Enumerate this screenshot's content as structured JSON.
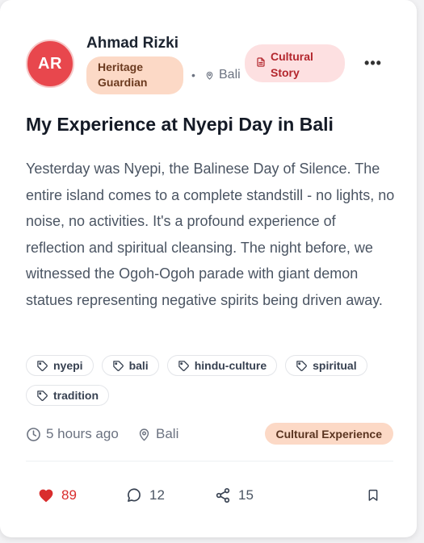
{
  "author": {
    "initials": "AR",
    "name": "Ahmad Rizki",
    "badge_line1": "Heritage",
    "badge_line2": "Guardian",
    "location": "Bali"
  },
  "post_type": {
    "line1": "Cultural",
    "line2": "Story",
    "icon": "document-icon"
  },
  "menu": {
    "icon": "more-horizontal-icon",
    "label": "•••"
  },
  "title": "My Experience at Nyepi Day in Bali",
  "body": "Yesterday was Nyepi, the Balinese Day of Silence. The entire island comes to a complete standstill - no lights, no noise, no activities. It's a profound experience of reflection and spiritual cleansing. The night before, we witnessed the Ogoh-Ogoh parade with giant demon statues representing negative spirits being driven away.",
  "tags": [
    "nyepi",
    "bali",
    "hindu-culture",
    "spiritual",
    "tradition"
  ],
  "meta": {
    "time": "5 hours ago",
    "location": "Bali",
    "category": "Cultural Experience"
  },
  "actions": {
    "likes": "89",
    "comments": "12",
    "shares": "15"
  },
  "colors": {
    "accent_red": "#e8474d",
    "like_red": "#d92d2d",
    "badge_peach": "#fcd9c6",
    "badge_pink": "#fde0e1"
  }
}
